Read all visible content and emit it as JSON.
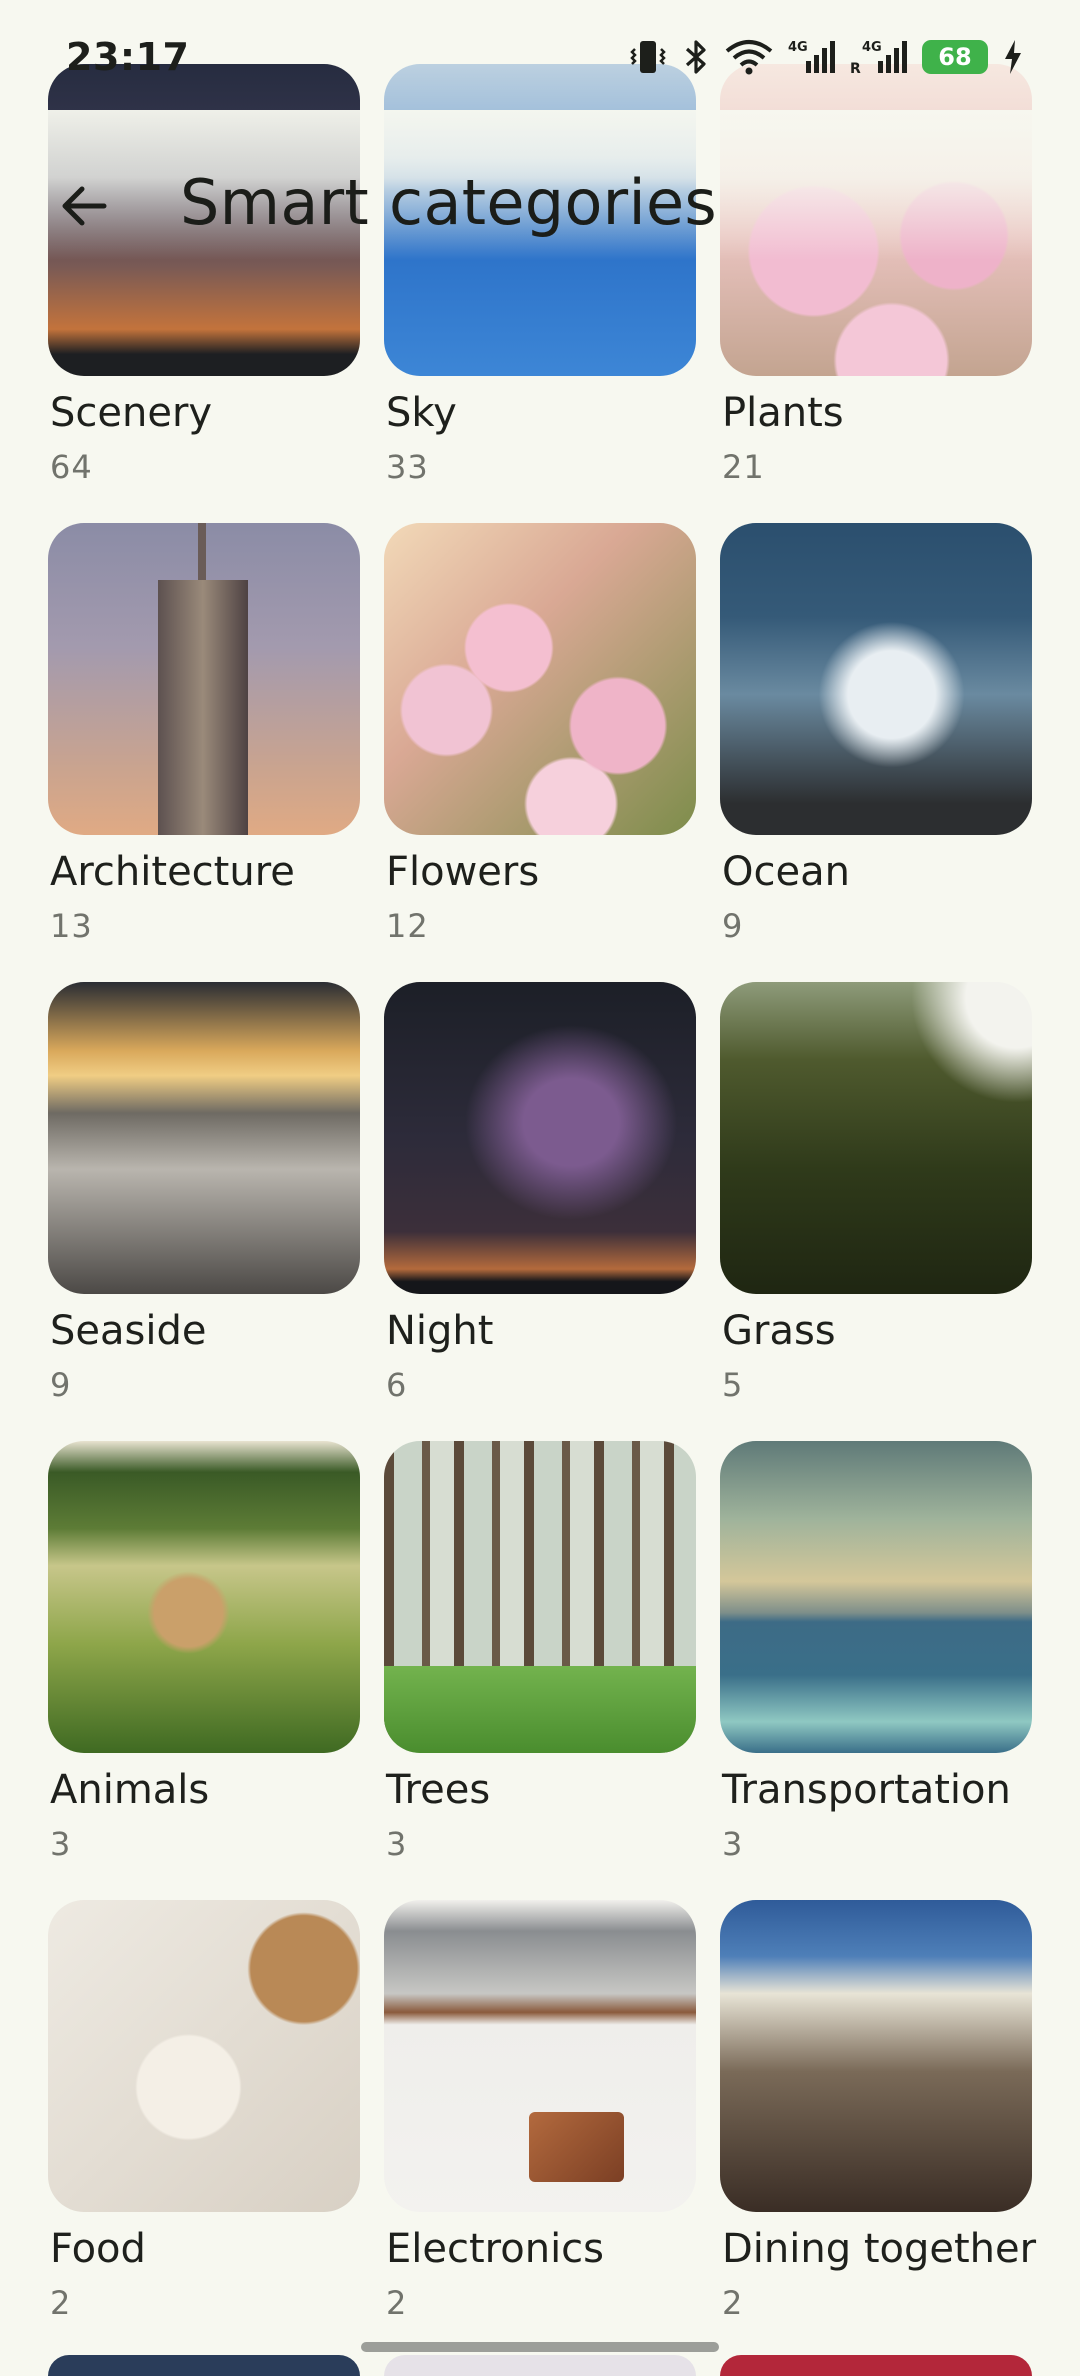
{
  "status_bar": {
    "time": "23:17",
    "battery": "68",
    "icons": [
      "vibrate-icon",
      "bluetooth-icon",
      "wifi-icon",
      "signal-4g-icon",
      "signal-4g-roaming-icon",
      "battery-icon",
      "charging-icon"
    ],
    "network_label_1": "4G",
    "network_label_2": "4G",
    "roaming_label": "R"
  },
  "header": {
    "title": "Smart categories",
    "back_icon": "arrow-left-icon"
  },
  "categories": [
    {
      "name": "Scenery",
      "count": "64"
    },
    {
      "name": "Sky",
      "count": "33"
    },
    {
      "name": "Plants",
      "count": "21"
    },
    {
      "name": "Architecture",
      "count": "13"
    },
    {
      "name": "Flowers",
      "count": "12"
    },
    {
      "name": "Ocean",
      "count": "9"
    },
    {
      "name": "Seaside",
      "count": "9"
    },
    {
      "name": "Night",
      "count": "6"
    },
    {
      "name": "Grass",
      "count": "5"
    },
    {
      "name": "Animals",
      "count": "3"
    },
    {
      "name": "Trees",
      "count": "3"
    },
    {
      "name": "Transportation",
      "count": "3"
    },
    {
      "name": "Food",
      "count": "2"
    },
    {
      "name": "Electronics",
      "count": "2"
    },
    {
      "name": "Dining together",
      "count": "2"
    }
  ],
  "colors": {
    "background": "#f7f8f0",
    "battery_green": "#3fb24a",
    "count_gray": "#71736c"
  }
}
